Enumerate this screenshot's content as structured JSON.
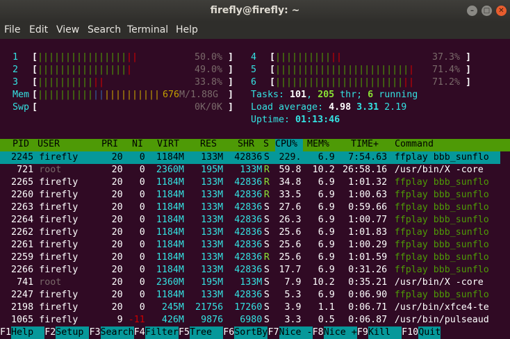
{
  "window": {
    "title": "firefly@firefly: ~"
  },
  "menu": [
    "File",
    "Edit",
    "View",
    "Search",
    "Terminal",
    "Help"
  ],
  "meters": {
    "cpu1": {
      "label": "1",
      "value": "50.0%"
    },
    "cpu2": {
      "label": "2",
      "value": "49.0%"
    },
    "cpu3": {
      "label": "3",
      "value": "33.8%"
    },
    "cpu4": {
      "label": "4",
      "value": "37.3%"
    },
    "cpu5": {
      "label": "5",
      "value": "71.4%"
    },
    "cpu6": {
      "label": "6",
      "value": "71.2%"
    },
    "mem": {
      "label": "Mem",
      "used": "676",
      "total": "M/1.88G"
    },
    "swp": {
      "label": "Swp",
      "value": "0K/0K"
    }
  },
  "stats": {
    "tasks_label": "Tasks: ",
    "tasks": "101",
    "thr": "205",
    "thr_label": " thr; ",
    "running": "6",
    "running_label": " running",
    "load_label": "Load average: ",
    "load1": "4.98",
    "load5": "3.31",
    "load15": "2.19",
    "uptime_label": "Uptime: ",
    "uptime": "01:13:46"
  },
  "columns": [
    "PID",
    "USER",
    "PRI",
    "NI",
    "VIRT",
    "RES",
    "SHR",
    "S",
    "CPU%",
    "MEM%",
    "TIME+",
    "Command"
  ],
  "processes": [
    {
      "pid": "2245",
      "user": "firefly",
      "pri": "20",
      "ni": "0",
      "virt": "1184M",
      "res": "133M",
      "shr": "42836",
      "s": "S",
      "cpu": "229.",
      "mem": "6.9",
      "time": "7:54.63",
      "cmd": "ffplay bbb_sunflo"
    },
    {
      "pid": "721",
      "user": "root",
      "pri": "20",
      "ni": "0",
      "virt": "2360M",
      "res": "195M",
      "shr": "133M",
      "s": "R",
      "cpu": "59.8",
      "mem": "10.2",
      "time": "26:58.16",
      "cmd": "/usr/bin/X -core"
    },
    {
      "pid": "2265",
      "user": "firefly",
      "pri": "20",
      "ni": "0",
      "virt": "1184M",
      "res": "133M",
      "shr": "42836",
      "s": "R",
      "cpu": "34.8",
      "mem": "6.9",
      "time": "1:01.32",
      "cmd": "ffplay bbb_sunflo"
    },
    {
      "pid": "2260",
      "user": "firefly",
      "pri": "20",
      "ni": "0",
      "virt": "1184M",
      "res": "133M",
      "shr": "42836",
      "s": "R",
      "cpu": "33.5",
      "mem": "6.9",
      "time": "1:00.63",
      "cmd": "ffplay bbb_sunflo"
    },
    {
      "pid": "2263",
      "user": "firefly",
      "pri": "20",
      "ni": "0",
      "virt": "1184M",
      "res": "133M",
      "shr": "42836",
      "s": "S",
      "cpu": "27.6",
      "mem": "6.9",
      "time": "0:59.66",
      "cmd": "ffplay bbb_sunflo"
    },
    {
      "pid": "2264",
      "user": "firefly",
      "pri": "20",
      "ni": "0",
      "virt": "1184M",
      "res": "133M",
      "shr": "42836",
      "s": "S",
      "cpu": "26.3",
      "mem": "6.9",
      "time": "1:00.77",
      "cmd": "ffplay bbb_sunflo"
    },
    {
      "pid": "2262",
      "user": "firefly",
      "pri": "20",
      "ni": "0",
      "virt": "1184M",
      "res": "133M",
      "shr": "42836",
      "s": "S",
      "cpu": "25.6",
      "mem": "6.9",
      "time": "1:01.83",
      "cmd": "ffplay bbb_sunflo"
    },
    {
      "pid": "2261",
      "user": "firefly",
      "pri": "20",
      "ni": "0",
      "virt": "1184M",
      "res": "133M",
      "shr": "42836",
      "s": "S",
      "cpu": "25.6",
      "mem": "6.9",
      "time": "1:00.29",
      "cmd": "ffplay bbb_sunflo"
    },
    {
      "pid": "2259",
      "user": "firefly",
      "pri": "20",
      "ni": "0",
      "virt": "1184M",
      "res": "133M",
      "shr": "42836",
      "s": "R",
      "cpu": "25.6",
      "mem": "6.9",
      "time": "1:01.59",
      "cmd": "ffplay bbb_sunflo"
    },
    {
      "pid": "2266",
      "user": "firefly",
      "pri": "20",
      "ni": "0",
      "virt": "1184M",
      "res": "133M",
      "shr": "42836",
      "s": "S",
      "cpu": "17.7",
      "mem": "6.9",
      "time": "0:31.26",
      "cmd": "ffplay bbb_sunflo"
    },
    {
      "pid": "741",
      "user": "root",
      "pri": "20",
      "ni": "0",
      "virt": "2360M",
      "res": "195M",
      "shr": "133M",
      "s": "S",
      "cpu": "7.9",
      "mem": "10.2",
      "time": "0:35.21",
      "cmd": "/usr/bin/X -core"
    },
    {
      "pid": "2247",
      "user": "firefly",
      "pri": "20",
      "ni": "0",
      "virt": "1184M",
      "res": "133M",
      "shr": "42836",
      "s": "S",
      "cpu": "5.3",
      "mem": "6.9",
      "time": "0:06.90",
      "cmd": "ffplay bbb_sunflo"
    },
    {
      "pid": "2198",
      "user": "firefly",
      "pri": "20",
      "ni": "0",
      "virt": "245M",
      "res": "21756",
      "shr": "17260",
      "s": "S",
      "cpu": "3.9",
      "mem": "1.1",
      "time": "0:06.71",
      "cmd": "/usr/bin/xfce4-te"
    },
    {
      "pid": "1065",
      "user": "firefly",
      "pri": "9",
      "ni": "-11",
      "virt": "426M",
      "res": "9876",
      "shr": "6980",
      "s": "S",
      "cpu": "3.3",
      "mem": "0.5",
      "time": "0:06.87",
      "cmd": "/usr/bin/pulseaud"
    }
  ],
  "fkeys": [
    {
      "key": "F1",
      "label": "Help  "
    },
    {
      "key": "F2",
      "label": "Setup "
    },
    {
      "key": "F3",
      "label": "Search"
    },
    {
      "key": "F4",
      "label": "Filter"
    },
    {
      "key": "F5",
      "label": "Tree  "
    },
    {
      "key": "F6",
      "label": "SortBy"
    },
    {
      "key": "F7",
      "label": "Nice -"
    },
    {
      "key": "F8",
      "label": "Nice +"
    },
    {
      "key": "F9",
      "label": "Kill  "
    },
    {
      "key": "F10",
      "label": "Quit"
    }
  ],
  "colors": {
    "background": "#300a24",
    "header": "#4e9a06",
    "selection": "#06989a",
    "cyan": "#34e2e2"
  }
}
